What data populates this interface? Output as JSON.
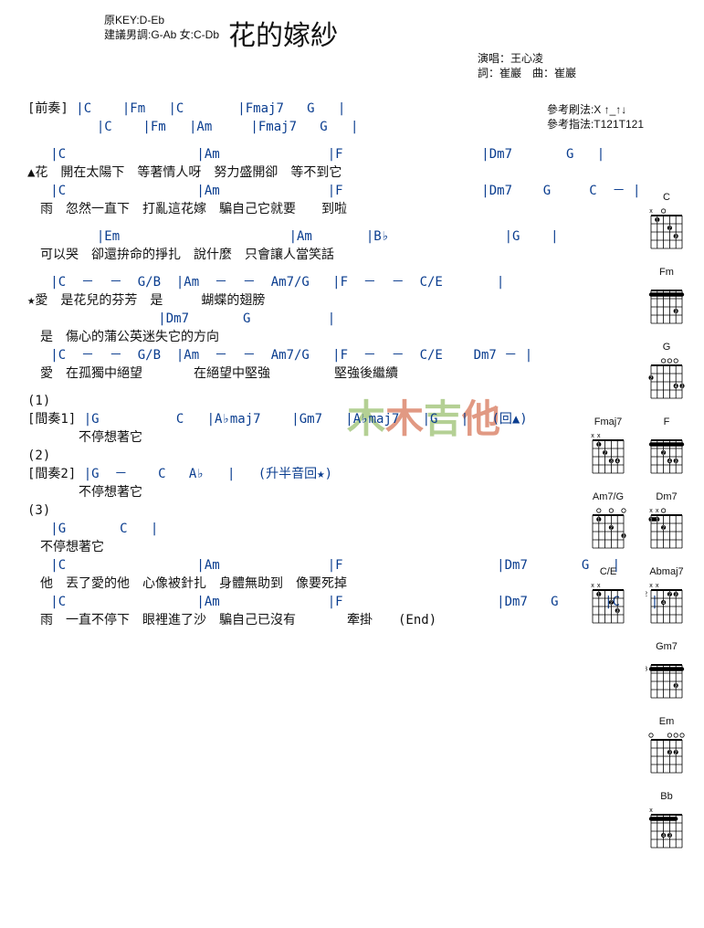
{
  "title": "花的嫁紗",
  "key_info": {
    "line1": "原KEY:D-Eb",
    "line2": "建議男調:G-Ab 女:C-Db"
  },
  "credits": {
    "line1": "演唱：王心凌",
    "line2": "詞：崔巖　曲：崔巖"
  },
  "tips": {
    "line1": "參考刷法:X ↑_↑↓",
    "line2": "參考指法:T121T121"
  },
  "watermark": [
    "木",
    "木",
    "吉",
    "他"
  ],
  "content_lines": [
    {
      "t": "mix",
      "parts": [
        {
          "c": 0,
          "v": "[前奏] "
        },
        {
          "c": 1,
          "v": "|C    |Fm   |C       |Fmaj7   G   |"
        }
      ]
    },
    {
      "t": "chord",
      "v": "         |C    |Fm   |Am     |Fmaj7   G   |"
    },
    {
      "t": "gap"
    },
    {
      "t": "chord",
      "v": "   |C                 |Am              |F                  |Dm7       G   |"
    },
    {
      "t": "lyric",
      "v": "▲花　開在太陽下　等著情人呀　努力盛開卻　等不到它"
    },
    {
      "t": "chord",
      "v": "   |C                 |Am              |F                  |Dm7    G     C  － |"
    },
    {
      "t": "lyric",
      "v": "　雨　忽然一直下　打亂這花嫁　騙自己它就要　　到啦"
    },
    {
      "t": "gap"
    },
    {
      "t": "chord",
      "v": "         |Em                      |Am       |B♭               |G    |"
    },
    {
      "t": "lyric",
      "v": "　可以哭　卻還拚命的掙扎　說什麼　只會讓人當笑話"
    },
    {
      "t": "gap"
    },
    {
      "t": "chord",
      "v": "   |C  －  －  G/B  |Am  －  －  Am7/G   |F  －  －  C/E       |"
    },
    {
      "t": "lyric",
      "v": "★愛　是花兒的芬芳　是　　　蝴蝶的翅膀"
    },
    {
      "t": "chord",
      "v": "                 |Dm7       G          |"
    },
    {
      "t": "lyric",
      "v": "　是　傷心的蒲公英迷失它的方向"
    },
    {
      "t": "chord",
      "v": "   |C  －  －  G/B  |Am  －  －  Am7/G   |F  －  －  C/E    Dm7 － |"
    },
    {
      "t": "lyric",
      "v": "　愛　在孤獨中絕望　　　　在絕望中堅強　　　　　堅強後繼續"
    },
    {
      "t": "gap"
    },
    {
      "t": "lyric",
      "v": "(1)"
    },
    {
      "t": "mix",
      "parts": [
        {
          "c": 0,
          "v": "[間奏1] "
        },
        {
          "c": 1,
          "v": "|G          C   |A♭maj7    |Gm7   |A♭maj7   |G   |   (回▲)"
        }
      ]
    },
    {
      "t": "lyric",
      "v": "　　　　不停想著它"
    },
    {
      "t": "lyric",
      "v": "(2)"
    },
    {
      "t": "mix",
      "parts": [
        {
          "c": 0,
          "v": "[間奏2] "
        },
        {
          "c": 1,
          "v": "|G  －    C   A♭   |   (升半音回★)"
        }
      ]
    },
    {
      "t": "lyric",
      "v": "　　　　不停想著它"
    },
    {
      "t": "lyric",
      "v": "(3)"
    },
    {
      "t": "chord",
      "v": "   |G       C   |"
    },
    {
      "t": "lyric",
      "v": "　不停想著它"
    },
    {
      "t": "chord",
      "v": "   |C                 |Am              |F                    |Dm7       G   |"
    },
    {
      "t": "lyric",
      "v": "　他　丟了愛的他　心像被針扎　身體無助到　像要死掉"
    },
    {
      "t": "chord",
      "v": "   |C                 |Am              |F                    |Dm7   G      |C    |"
    },
    {
      "t": "lyric",
      "v": "　雨　一直不停下　眼裡進了沙　騙自己已沒有　　　　牽掛　　(End)"
    }
  ],
  "diagrams": [
    [
      {
        "name": "C"
      }
    ],
    [
      {
        "name": "Fm"
      }
    ],
    [
      {
        "name": "G"
      }
    ],
    [
      {
        "name": "Fmaj7"
      },
      {
        "name": "F"
      }
    ],
    [
      {
        "name": "Am7/G"
      },
      {
        "name": "Dm7"
      }
    ],
    [
      {
        "name": "C/E"
      },
      {
        "name": "Abmaj7"
      }
    ],
    [
      {
        "name": "Gm7"
      }
    ],
    [
      {
        "name": "Em"
      }
    ],
    [
      {
        "name": "Bb"
      }
    ]
  ],
  "diagram_details": {
    "C": {
      "open": [
        "x",
        "",
        "o",
        "",
        "",
        ""
      ],
      "dots": [
        [
          0,
          1,
          1
        ],
        [
          1,
          3,
          2
        ],
        [
          2,
          4,
          3
        ]
      ],
      "barre": null,
      "fret": ""
    },
    "Fm": {
      "open": [
        "",
        "",
        "",
        "",
        "",
        ""
      ],
      "dots": [
        [
          2,
          4,
          3
        ]
      ],
      "barre": [
        0,
        0,
        5
      ],
      "fret": ""
    },
    "G": {
      "open": [
        "",
        "",
        "o",
        "o",
        "o",
        ""
      ],
      "dots": [
        [
          1,
          0,
          2
        ],
        [
          2,
          5,
          3
        ],
        [
          2,
          4,
          4
        ]
      ],
      "barre": null,
      "fret": ""
    },
    "Fmaj7": {
      "open": [
        "x",
        "x",
        "",
        "",
        "",
        ""
      ],
      "dots": [
        [
          0,
          1,
          1
        ],
        [
          1,
          2,
          2
        ],
        [
          2,
          3,
          3
        ],
        [
          2,
          4,
          4
        ]
      ],
      "barre": null,
      "fret": ""
    },
    "F": {
      "open": [
        "",
        "",
        "",
        "",
        "",
        ""
      ],
      "dots": [
        [
          1,
          2,
          2
        ],
        [
          2,
          4,
          3
        ],
        [
          2,
          3,
          4
        ]
      ],
      "barre": [
        0,
        0,
        5
      ],
      "fret": ""
    },
    "Am7/G": {
      "open": [
        "",
        "o",
        "",
        "o",
        "",
        "o"
      ],
      "dots": [
        [
          0,
          1,
          1
        ],
        [
          1,
          3,
          2
        ],
        [
          2,
          5,
          3
        ]
      ],
      "barre": null,
      "fret": ""
    },
    "Dm7": {
      "open": [
        "x",
        "x",
        "o",
        "",
        "",
        ""
      ],
      "dots": [
        [
          0,
          1,
          1
        ],
        [
          0,
          0,
          1
        ],
        [
          1,
          2,
          2
        ]
      ],
      "barre": [
        0,
        0,
        1
      ],
      "fret": ""
    },
    "C/E": {
      "open": [
        "x",
        "x",
        "",
        "",
        "",
        ""
      ],
      "dots": [
        [
          0,
          1,
          1
        ],
        [
          1,
          3,
          2
        ],
        [
          2,
          4,
          3
        ]
      ],
      "barre": null,
      "fret": ""
    },
    "Abmaj7": {
      "open": [
        "x",
        "x",
        "",
        "",
        "",
        ""
      ],
      "dots": [
        [
          0,
          3,
          2
        ],
        [
          0,
          4,
          3
        ],
        [
          1,
          2,
          4
        ]
      ],
      "barre": null,
      "fret": "2"
    },
    "Gm7": {
      "open": [
        "",
        "",
        "",
        "",
        "",
        ""
      ],
      "dots": [
        [
          2,
          4,
          3
        ]
      ],
      "barre": [
        0,
        0,
        5
      ],
      "fret": "3"
    },
    "Em": {
      "open": [
        "o",
        "",
        "",
        "o",
        "o",
        "o"
      ],
      "dots": [
        [
          1,
          4,
          2
        ],
        [
          1,
          3,
          3
        ]
      ],
      "barre": null,
      "fret": ""
    },
    "Bb": {
      "open": [
        "x",
        "",
        "",
        "",
        "",
        ""
      ],
      "dots": [
        [
          2,
          3,
          3
        ],
        [
          2,
          2,
          4
        ]
      ],
      "barre": [
        0,
        0,
        4
      ],
      "fret": ""
    }
  }
}
